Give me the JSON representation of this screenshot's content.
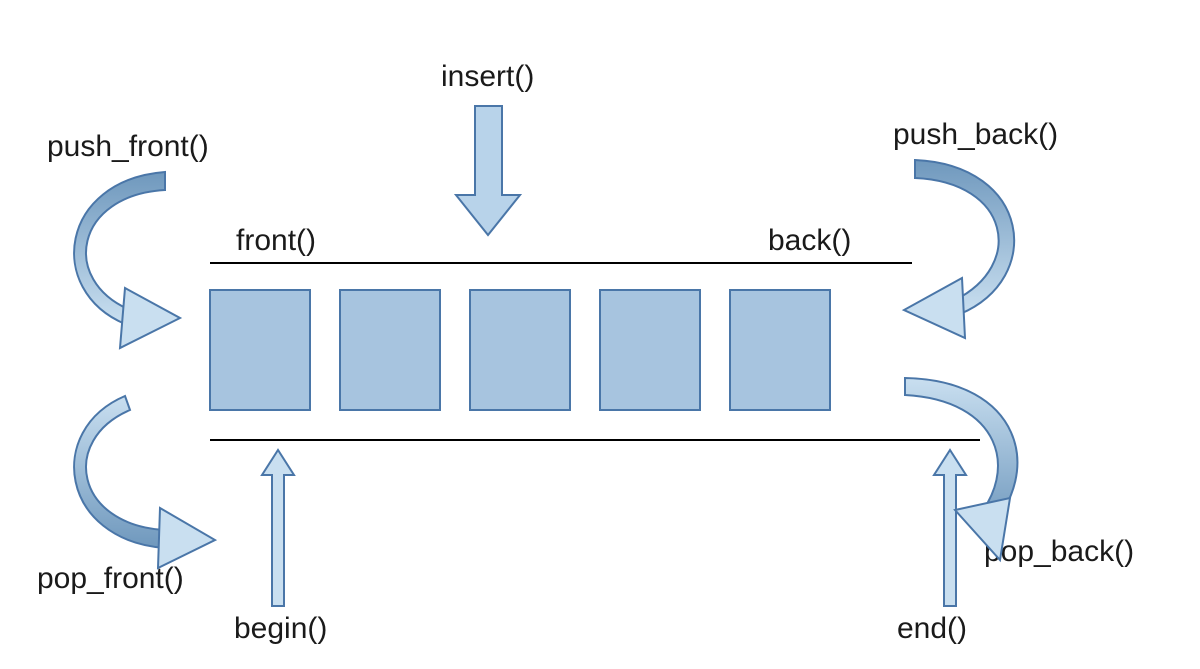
{
  "labels": {
    "insert": "insert()",
    "push_front": "push_front()",
    "push_back": "push_back()",
    "pop_front": "pop_front()",
    "pop_back": "pop_back()",
    "front": "front()",
    "back": "back()",
    "begin": "begin()",
    "end": "end()"
  },
  "colors": {
    "box_fill": "#a7c4df",
    "box_stroke": "#4a76a8",
    "arrow_fill": "#b8d3ea",
    "arrow_stroke": "#4a76a8",
    "line": "#000000"
  },
  "deque": {
    "element_count": 5
  }
}
